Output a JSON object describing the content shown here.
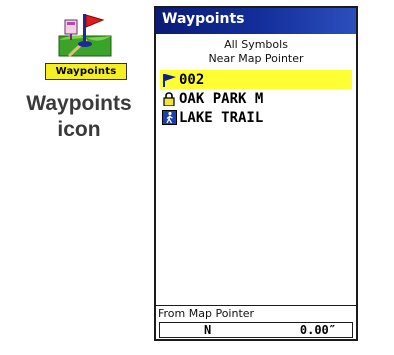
{
  "icon": {
    "name": "waypoints-app-icon",
    "label": "Waypoints"
  },
  "caption": {
    "line1": "Waypoints",
    "line2": "icon"
  },
  "screen": {
    "title": "Waypoints",
    "filter": "All Symbols",
    "reference": "Near Map Pointer",
    "waypoints": [
      {
        "name": "002",
        "symbol": "flag-icon",
        "selected": true
      },
      {
        "name": "OAK PARK M",
        "symbol": "lock-icon",
        "selected": false
      },
      {
        "name": "LAKE TRAIL",
        "symbol": "hiker-icon",
        "selected": false
      }
    ],
    "footer": {
      "label": "From Map Pointer",
      "direction": "N",
      "distance": "0.00″"
    }
  },
  "colors": {
    "titlebar": "#14309c",
    "selection": "#ffff33",
    "icon_label_bg": "#f4ee22"
  }
}
